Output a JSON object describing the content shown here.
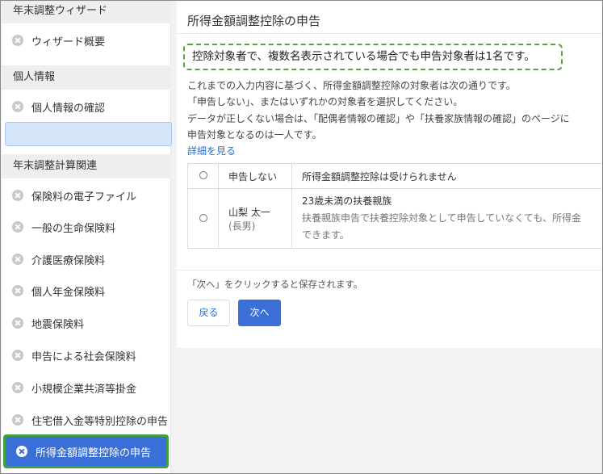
{
  "sidebar": {
    "sections": [
      {
        "title": "年末調整ウィザード"
      },
      {
        "title": "個人情報"
      },
      {
        "title": "年末調整計算関連"
      }
    ],
    "items": [
      {
        "label": "ウィザード概要"
      },
      {
        "label": "個人情報の確認"
      },
      {
        "label": "保険料の電子ファイル"
      },
      {
        "label": "一般の生命保険料"
      },
      {
        "label": "介護医療保険料"
      },
      {
        "label": "個人年金保険料"
      },
      {
        "label": "地震保険料"
      },
      {
        "label": "申告による社会保険料"
      },
      {
        "label": "小規模企業共済等掛金"
      },
      {
        "label": "住宅借入金等特別控除の申告"
      },
      {
        "label": "所得金額調整控除の申告"
      }
    ]
  },
  "main": {
    "title": "所得金額調整控除の申告",
    "notice": "控除対象者で、複数名表示されている場合でも申告対象者は1名です。",
    "desc_lines": [
      "これまでの入力内容に基づく、所得金額調整控除の対象者は次の通りです。",
      "「申告しない」、またはいずれかの対象者を選択してください。",
      "データが正しくない場合は、「配偶者情報の確認」や「扶養家族情報の確認」のページに",
      "申告対象となるのは一人です。"
    ],
    "detail_link": "詳細を見る",
    "options": [
      {
        "name": "申告しない",
        "sub": "",
        "desc": "所得金額調整控除は受けられません",
        "desc2": "",
        "desc3": ""
      },
      {
        "name": "山梨 太一",
        "sub": "(長男)",
        "desc": "23歳未満の扶養親族",
        "desc2": "扶養親族申告で扶養控除対象として申告していなくても、所得金",
        "desc3": "できます。"
      }
    ],
    "save_note": "「次へ」をクリックすると保存されます。",
    "back_label": "戻る",
    "next_label": "次へ"
  },
  "colors": {
    "accent": "#3a6fd8",
    "highlight_border": "#3fa03f",
    "notice_border": "#5aa33c",
    "link": "#2a6fcf"
  }
}
